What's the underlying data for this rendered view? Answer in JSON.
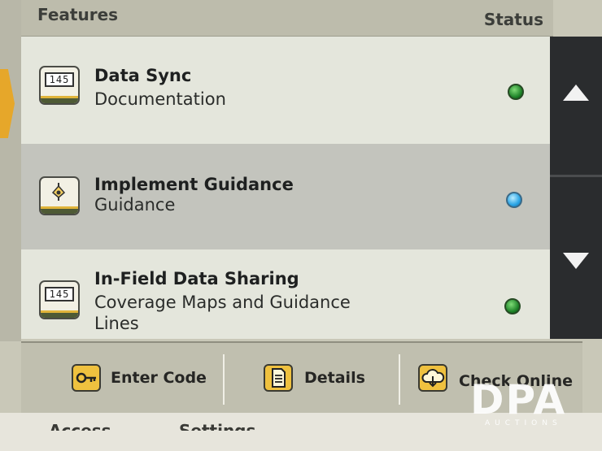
{
  "header": {
    "features_label": "Features",
    "status_label": "Status"
  },
  "features": [
    {
      "title": "Data Sync",
      "subtitle": "Documentation",
      "icon": "counter-icon",
      "counter_text": "145",
      "status": "green"
    },
    {
      "title": "Implement Guidance",
      "subtitle": "Guidance",
      "icon": "guidance-icon",
      "status": "blue"
    },
    {
      "title": "In-Field Data Sharing",
      "subtitle": "Coverage Maps and Guidance Lines",
      "icon": "counter-icon",
      "counter_text": "145",
      "status": "green"
    }
  ],
  "status_colors": {
    "green": "#1b7f26",
    "blue": "#2aa4e5"
  },
  "buttons": [
    {
      "label": "Enter Code",
      "icon": "key-icon"
    },
    {
      "label": "Details",
      "icon": "document-icon"
    },
    {
      "label": "Check Online",
      "icon": "cloud-download-icon"
    }
  ],
  "bezel": {
    "left_label": "Access",
    "right_label": "Settings"
  },
  "watermark": {
    "brand": "DPA",
    "tagline": "AUCTIONS"
  },
  "accent_color": "#efc13f"
}
